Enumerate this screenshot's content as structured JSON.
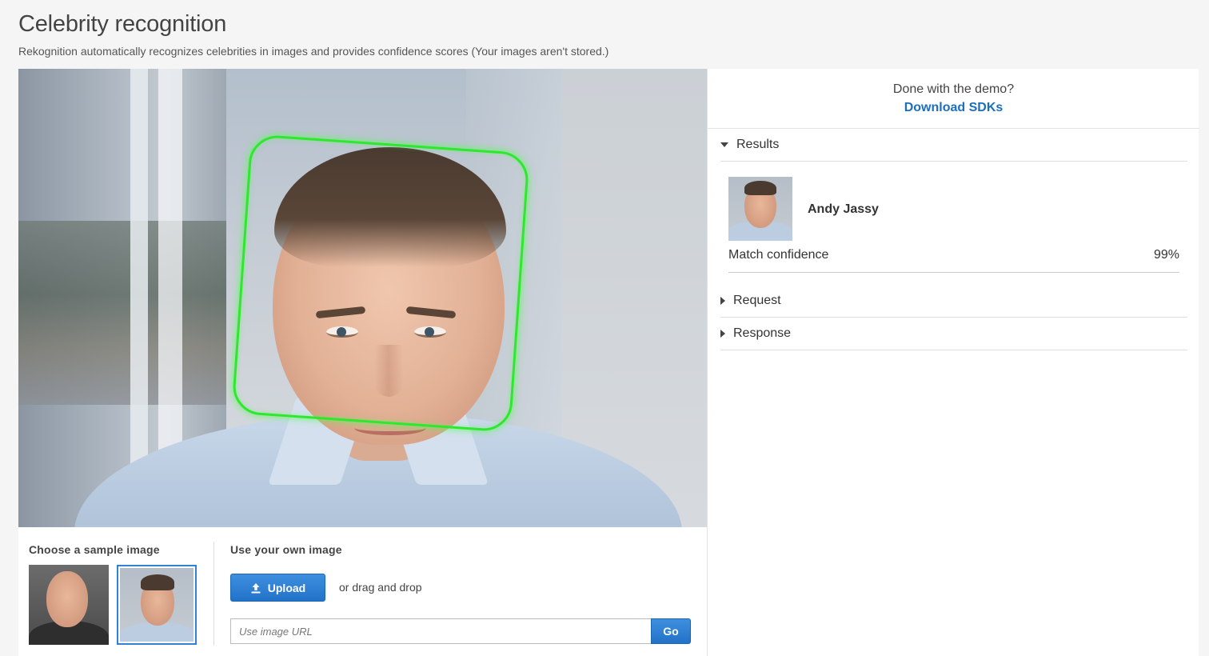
{
  "page": {
    "title": "Celebrity recognition",
    "subtitle": "Rekognition automatically recognizes celebrities in images and provides confidence scores (Your images aren't stored.)"
  },
  "controls": {
    "sample_heading": "Choose a sample image",
    "own_heading": "Use your own image",
    "upload_label": "Upload",
    "drag_text": "or drag and drop",
    "url_placeholder": "Use image URL",
    "url_value": "",
    "go_label": "Go",
    "selected_sample": 2
  },
  "right_panel": {
    "done_text": "Done with the demo?",
    "sdk_link": "Download SDKs",
    "sections": {
      "results": "Results",
      "request": "Request",
      "response": "Response"
    },
    "result": {
      "name": "Andy Jassy",
      "match_label": "Match confidence",
      "match_value": "99%"
    }
  },
  "colors": {
    "accent": "#2272c8",
    "link": "#1a6fc0",
    "face_box": "#2ee82e"
  },
  "icons": [
    "upload-icon",
    "caret-down-icon",
    "caret-right-icon"
  ]
}
